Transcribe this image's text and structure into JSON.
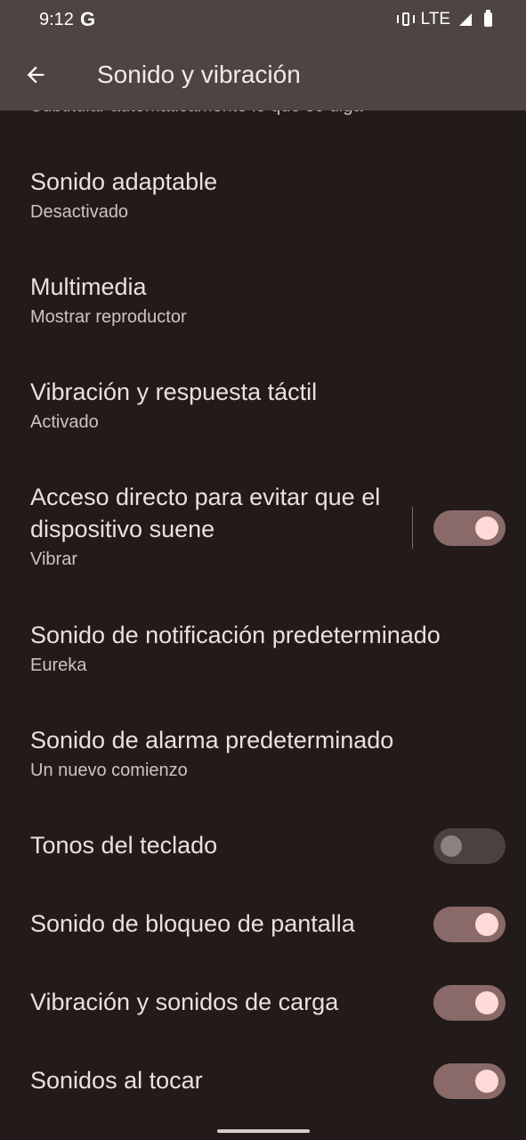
{
  "status": {
    "time": "9:12",
    "network": "LTE"
  },
  "appbar": {
    "title": "Sonido y vibración"
  },
  "partial_text": "Subtitular automáticamente lo que se diga",
  "items": [
    {
      "title": "Sonido adaptable",
      "subtitle": "Desactivado"
    },
    {
      "title": "Multimedia",
      "subtitle": "Mostrar reproductor"
    },
    {
      "title": "Vibración y respuesta táctil",
      "subtitle": "Activado"
    },
    {
      "title": "Acceso directo para evitar que el dispositivo suene",
      "subtitle": "Vibrar",
      "toggle": true
    },
    {
      "title": "Sonido de notificación predeterminado",
      "subtitle": "Eureka"
    },
    {
      "title": "Sonido de alarma predeterminado",
      "subtitle": "Un nuevo comienzo"
    },
    {
      "title": "Tonos del teclado",
      "toggle": false
    },
    {
      "title": "Sonido de bloqueo de pantalla",
      "toggle": true
    },
    {
      "title": "Vibración y sonidos de carga",
      "toggle": true
    },
    {
      "title": "Sonidos al tocar",
      "toggle": true
    }
  ],
  "colors": {
    "background": "#231b1a",
    "bar": "#4e4442",
    "toggle_on": "#8a6a69",
    "knob_on": "#ffdad7"
  }
}
